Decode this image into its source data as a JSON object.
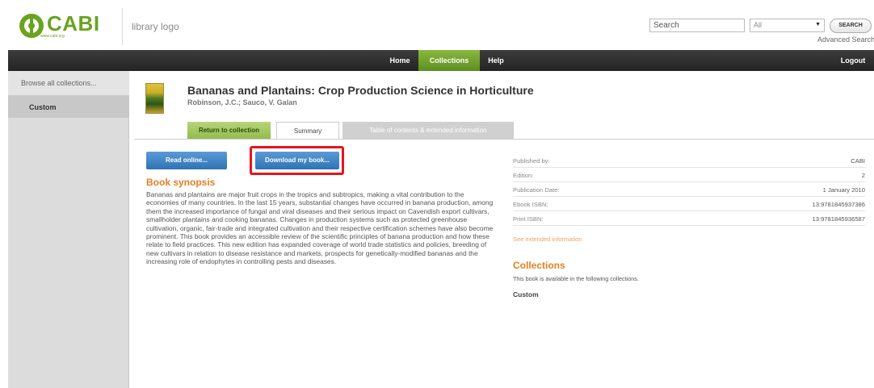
{
  "header": {
    "logo_text": "CABI",
    "logo_url": "www.cabi.org",
    "library_logo": "library logo",
    "search_placeholder": "Search",
    "search_scope": "All",
    "search_button": "SEARCH",
    "advanced_search": "Advanced Search"
  },
  "navbar": {
    "items": [
      {
        "label": "Home"
      },
      {
        "label": "Collections"
      },
      {
        "label": "Help"
      }
    ],
    "logout": "Logout",
    "active_color": "#6f9f2a"
  },
  "sidebar": {
    "browse_all": "Browse all collections...",
    "items": [
      {
        "label": "Custom"
      }
    ]
  },
  "book": {
    "title": "Bananas and Plantains: Crop Production Science in Horticulture",
    "authors": "Robinson, J.C.; Sauco, V. Galan"
  },
  "tabs": {
    "return": "Return to collection",
    "summary": "Summary",
    "toc": "Table of contents & extended information"
  },
  "actions": {
    "read_online": "Read online...",
    "download": "Download my book..."
  },
  "synopsis": {
    "heading": "Book synopsis",
    "text": "Bananas and plantains are major fruit crops in the tropics and subtropics, making a vital contribution to the economies of many countries. In the last 15 years, substantial changes have occurred in banana production, among them the increased importance of fungal and viral diseases and their serious impact on Cavendish export cultivars, smallholder plantains and cooking bananas. Changes in production systems such as protected greenhouse cultivation, organic, fair-trade and integrated cultivation and their respective certification schemes have also become prominent. This book provides an accessible review of the scientific principles of banana production and how these relate to field practices. This new edition has expanded coverage of world trade statistics and policies, breeding of new cultivars in relation to disease resistance and markets, prospects for genetically-modified bananas and the increasing role of endophytes in controlling pests and diseases."
  },
  "details": {
    "rows": [
      {
        "label": "Published by:",
        "value": "CABI"
      },
      {
        "label": "Edition:",
        "value": "2"
      },
      {
        "label": "Publication Date:",
        "value": "1 January 2010"
      },
      {
        "label": "Ebook ISBN:",
        "value": "13:9781845937386"
      },
      {
        "label": "Print ISBN:",
        "value": "13:9781845936587"
      }
    ],
    "see_extended": "See extended information"
  },
  "collections": {
    "heading": "Collections",
    "description": "This book is available in the following collections.",
    "items": [
      {
        "label": "Custom"
      }
    ]
  },
  "colors": {
    "accent_orange": "#e67e22",
    "brand_green": "#6aa31f",
    "button_blue": "#3a7fc1",
    "highlight_red": "#e8141d"
  }
}
